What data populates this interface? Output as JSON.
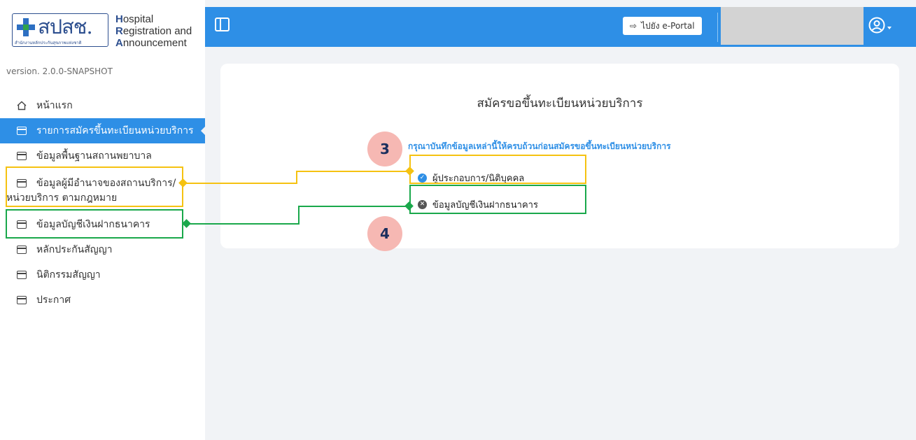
{
  "logo": {
    "thai": "สปสช.",
    "thai_sub": "สำนักงานหลักประกันสุขภาพแห่งชาติ",
    "en_lines": [
      {
        "first": "H",
        "rest": "ospital"
      },
      {
        "first": "R",
        "rest": "egistration and"
      },
      {
        "first": "A",
        "rest": "nnouncement"
      }
    ]
  },
  "version": "version. 2.0.0-SNAPSHOT",
  "sidebar": {
    "items": [
      {
        "label": "หน้าแรก"
      },
      {
        "label": "รายการสมัครขึ้นทะเบียนหน่วยบริการ"
      },
      {
        "label": "ข้อมูลพื้นฐานสถานพยาบาล"
      },
      {
        "label_line1": "ข้อมูลผู้มีอำนาจของสถานบริการ/",
        "label_line2": "หน่วยบริการ ตามกฎหมาย"
      },
      {
        "label": "ข้อมูลบัญชีเงินฝากธนาคาร"
      },
      {
        "label": "หลักประกันสัญญา"
      },
      {
        "label": "นิติกรรมสัญญา"
      },
      {
        "label": "ประกาศ"
      }
    ]
  },
  "header": {
    "portal_label": "ไปยัง e-Portal"
  },
  "main": {
    "title": "สมัครขอขึ้นทะเบียนหน่วยบริการ",
    "instruction": "กรุณาบันทึกข้อมูลเหล่านี้ให้ครบถ้วนก่อนสมัครขอขึ้นทะเบียนหน่วยบริการ",
    "requirements": [
      {
        "label": "ผู้ประกอบการ/นิติบุคคล",
        "status": "complete"
      },
      {
        "label": "ข้อมูลบัญชีเงินฝากธนาคาร",
        "status": "incomplete"
      }
    ]
  },
  "annotations": {
    "badge_3": "3",
    "badge_4": "4"
  },
  "colors": {
    "primary": "#2e8fe6",
    "annotation_yellow": "#f5c211",
    "annotation_green": "#1aa84b",
    "badge_bg": "#f6b8b3"
  }
}
